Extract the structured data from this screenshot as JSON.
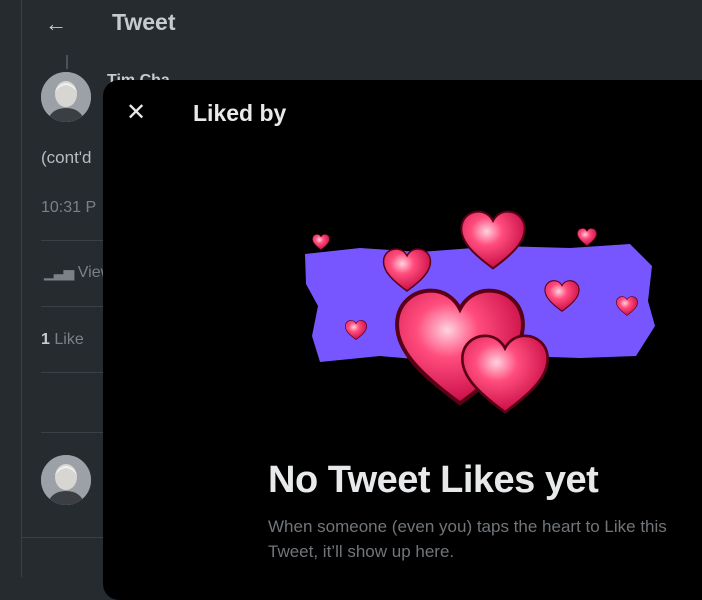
{
  "header": {
    "title": "Tweet",
    "back_icon": "arrow-left-icon"
  },
  "tweet": {
    "author_name": "Tim Cha...",
    "text": "(cont'd",
    "time": "10:31 P",
    "views_label": "View",
    "likes_count": "1",
    "likes_label": "Like"
  },
  "modal": {
    "title": "Liked by",
    "close_icon": "close-icon",
    "empty_heading": "No Tweet Likes yet",
    "empty_text": "When someone (even you) taps the heart to Like this Tweet, it’ll show up here."
  },
  "colors": {
    "accent_purple": "#7856ff",
    "heart_pink": "#f91880",
    "modal_bg": "#000000"
  }
}
